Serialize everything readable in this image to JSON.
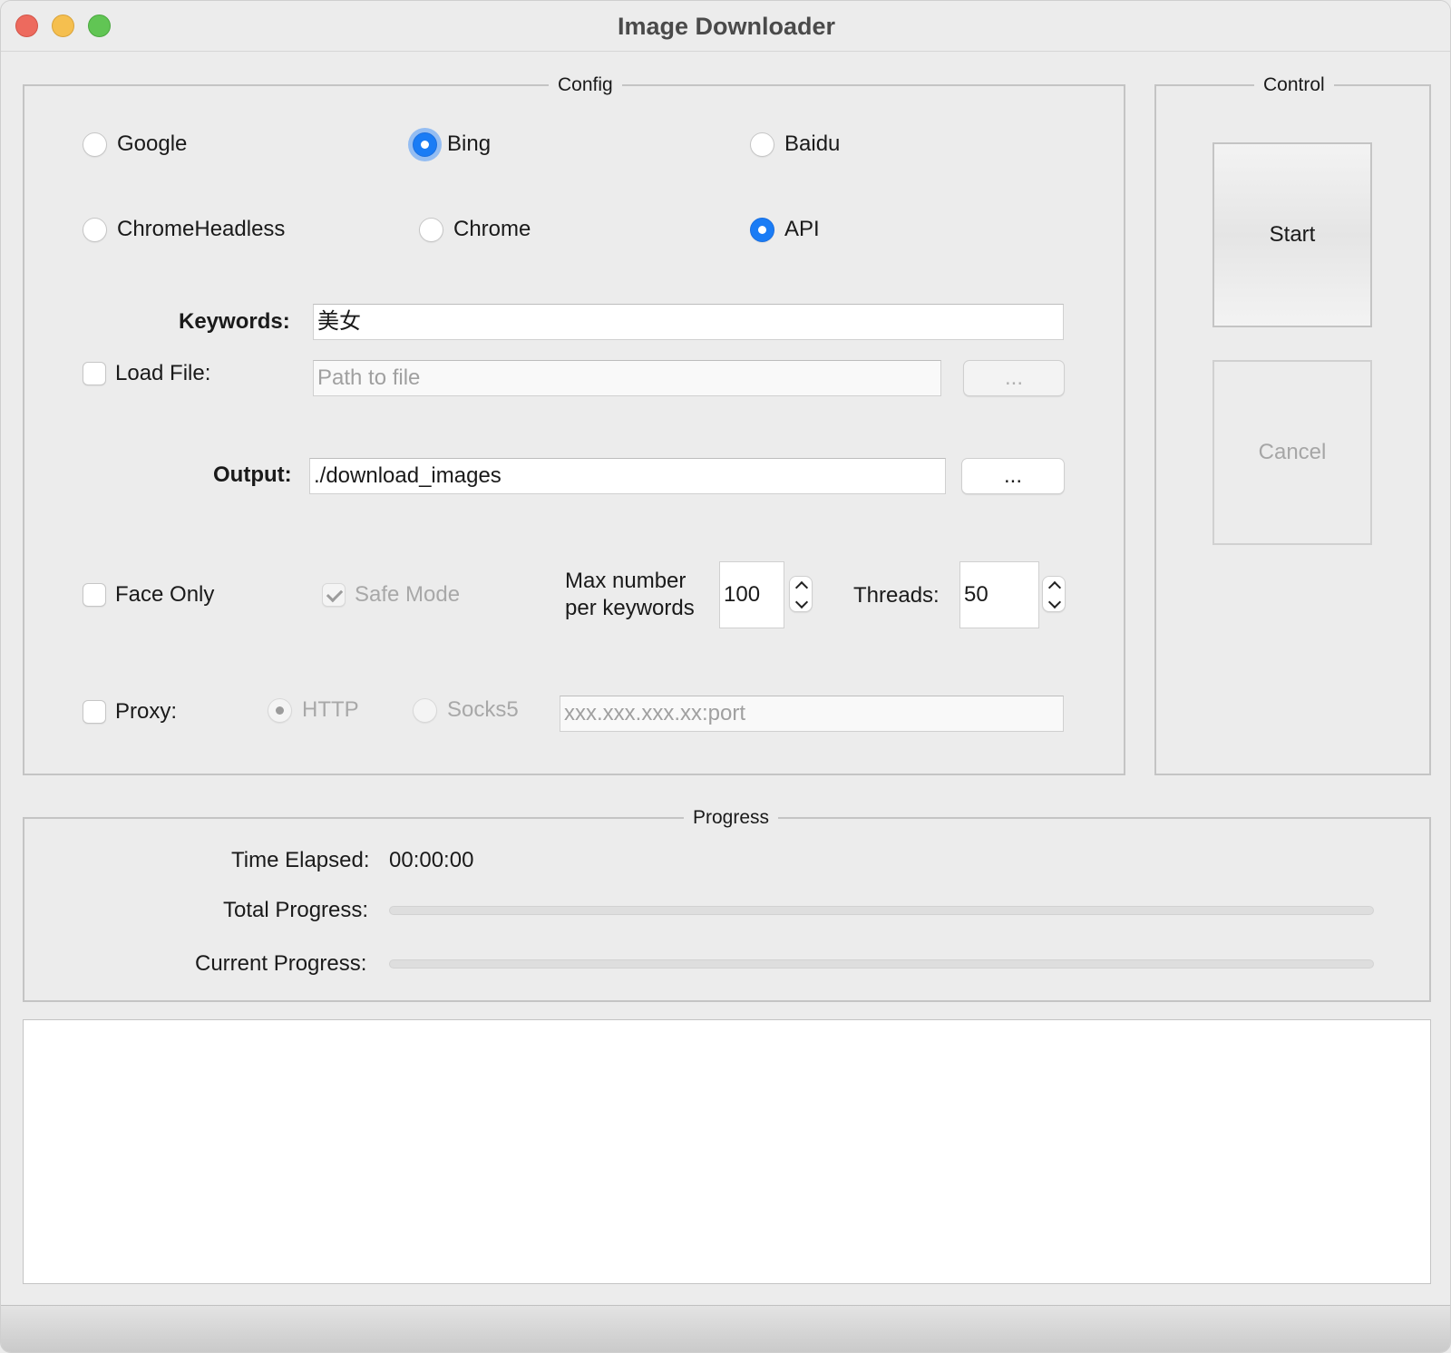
{
  "window": {
    "title": "Image Downloader"
  },
  "config": {
    "title": "Config",
    "engines": [
      {
        "label": "Google",
        "checked": false
      },
      {
        "label": "Bing",
        "checked": true
      },
      {
        "label": "Baidu",
        "checked": false
      }
    ],
    "drivers": [
      {
        "label": "ChromeHeadless",
        "checked": false
      },
      {
        "label": "Chrome",
        "checked": false
      },
      {
        "label": "API",
        "checked": true
      }
    ],
    "keywords": {
      "label": "Keywords:",
      "value": "美女"
    },
    "load_file": {
      "label": "Load File:",
      "checked": false,
      "placeholder": "Path to file",
      "browse_label": "..."
    },
    "output": {
      "label": "Output:",
      "value": "./download_images",
      "browse_label": "..."
    },
    "face_only": {
      "label": "Face Only",
      "checked": false
    },
    "safe_mode": {
      "label": "Safe Mode",
      "checked": true,
      "disabled": true
    },
    "max_number": {
      "label_line1": "Max number",
      "label_line2": "per keywords",
      "value": "100"
    },
    "threads": {
      "label": "Threads:",
      "value": "50"
    },
    "proxy": {
      "label": "Proxy:",
      "checked": false,
      "types": [
        {
          "label": "HTTP",
          "checked": true
        },
        {
          "label": "Socks5",
          "checked": false
        }
      ],
      "placeholder": "xxx.xxx.xxx.xx:port"
    }
  },
  "control": {
    "title": "Control",
    "start_label": "Start",
    "cancel_label": "Cancel"
  },
  "progress": {
    "title": "Progress",
    "time_elapsed_label": "Time Elapsed:",
    "time_elapsed_value": "00:00:00",
    "total_label": "Total Progress:",
    "total_value": 0,
    "current_label": "Current Progress:",
    "current_value": 0
  },
  "colors": {
    "accent": "#1a7cf5",
    "close": "#ed6a5e",
    "minimize": "#f5bf4f",
    "maximize": "#61c554"
  }
}
